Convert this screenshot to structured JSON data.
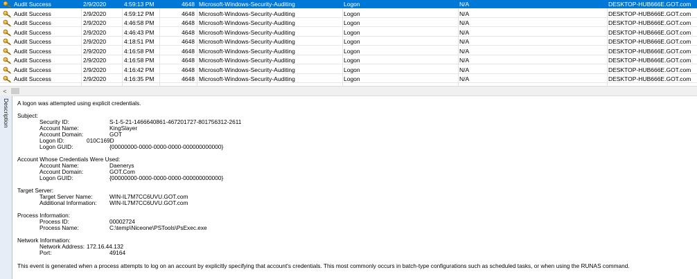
{
  "events": [
    {
      "level": "Audit Success",
      "date": "2/9/2020",
      "time": "4:59:13 PM",
      "event_id": "4648",
      "source": "Microsoft-Windows-Security-Auditing",
      "task": "Logon",
      "user": "N/A",
      "computer": "DESKTOP-HUB666E.GOT.com",
      "selected": true,
      "icon": "key-icon"
    },
    {
      "level": "Audit Success",
      "date": "2/9/2020",
      "time": "4:59:12 PM",
      "event_id": "4648",
      "source": "Microsoft-Windows-Security-Auditing",
      "task": "Logon",
      "user": "N/A",
      "computer": "DESKTOP-HUB666E.GOT.com",
      "icon": "key-icon"
    },
    {
      "level": "Audit Success",
      "date": "2/9/2020",
      "time": "4:46:58 PM",
      "event_id": "4648",
      "source": "Microsoft-Windows-Security-Auditing",
      "task": "Logon",
      "user": "N/A",
      "computer": "DESKTOP-HUB666E.GOT.com",
      "icon": "key-icon"
    },
    {
      "level": "Audit Success",
      "date": "2/9/2020",
      "time": "4:46:43 PM",
      "event_id": "4648",
      "source": "Microsoft-Windows-Security-Auditing",
      "task": "Logon",
      "user": "N/A",
      "computer": "DESKTOP-HUB666E.GOT.com",
      "icon": "key-icon"
    },
    {
      "level": "Audit Success",
      "date": "2/9/2020",
      "time": "4:18:51 PM",
      "event_id": "4648",
      "source": "Microsoft-Windows-Security-Auditing",
      "task": "Logon",
      "user": "N/A",
      "computer": "DESKTOP-HUB666E.GOT.com",
      "icon": "key-icon"
    },
    {
      "level": "Audit Success",
      "date": "2/9/2020",
      "time": "4:16:58 PM",
      "event_id": "4648",
      "source": "Microsoft-Windows-Security-Auditing",
      "task": "Logon",
      "user": "N/A",
      "computer": "DESKTOP-HUB666E.GOT.com",
      "icon": "key-icon"
    },
    {
      "level": "Audit Success",
      "date": "2/9/2020",
      "time": "4:16:58 PM",
      "event_id": "4648",
      "source": "Microsoft-Windows-Security-Auditing",
      "task": "Logon",
      "user": "N/A",
      "computer": "DESKTOP-HUB666E.GOT.com",
      "icon": "key-icon"
    },
    {
      "level": "Audit Success",
      "date": "2/9/2020",
      "time": "4:16:42 PM",
      "event_id": "4648",
      "source": "Microsoft-Windows-Security-Auditing",
      "task": "Logon",
      "user": "N/A",
      "computer": "DESKTOP-HUB666E.GOT.com",
      "icon": "key-icon"
    },
    {
      "level": "Audit Success",
      "date": "2/9/2020",
      "time": "4:16:35 PM",
      "event_id": "4648",
      "source": "Microsoft-Windows-Security-Auditing",
      "task": "Logon",
      "user": "N/A",
      "computer": "DESKTOP-HUB666E.GOT.com",
      "icon": "key-icon"
    }
  ],
  "scrollbar": {
    "left_arrow": "<"
  },
  "description": {
    "tab_label": "Description",
    "intro": "A logon was attempted using explicit credentials.",
    "subject": {
      "header": "Subject:",
      "security_id_label": "Security ID:",
      "security_id": "S-1-5-21-1466640861-467201727-801756312-2611",
      "account_name_label": "Account Name:",
      "account_name": "KingSlayer",
      "account_domain_label": "Account Domain:",
      "account_domain": "GOT",
      "logon_id_label": "Logon ID:",
      "logon_id": "010C169D",
      "logon_guid_label": "Logon GUID:",
      "logon_guid": "{00000000-0000-0000-0000-000000000000}"
    },
    "credentials": {
      "header": "Account Whose Credentials Were Used:",
      "account_name_label": "Account Name:",
      "account_name": "Daenerys",
      "account_domain_label": "Account Domain:",
      "account_domain": "GOT.Com",
      "logon_guid_label": "Logon GUID:",
      "logon_guid": "{00000000-0000-0000-0000-000000000000}"
    },
    "target": {
      "header": "Target Server:",
      "server_name_label": "Target Server Name:",
      "server_name": "WIN-IL7M7CC6UVU.GOT.com",
      "additional_info_label": "Additional Information:",
      "additional_info": "WIN-IL7M7CC6UVU.GOT.com"
    },
    "process": {
      "header": "Process Information:",
      "process_id_label": "Process ID:",
      "process_id": "00002724",
      "process_name_label": "Process Name:",
      "process_name": "C:\\temp\\Niceone\\PSTools\\PsExec.exe"
    },
    "network": {
      "header": "Network Information:",
      "address_label": "Network Address:",
      "address": "172.16.44.132",
      "port_label": "Port:",
      "port": "49164"
    },
    "footer": "This event is generated when a process attempts to log on an account by explicitly specifying that account's credentials.  This most commonly occurs in batch-type configurations such as scheduled tasks, or when using the RUNAS command."
  }
}
